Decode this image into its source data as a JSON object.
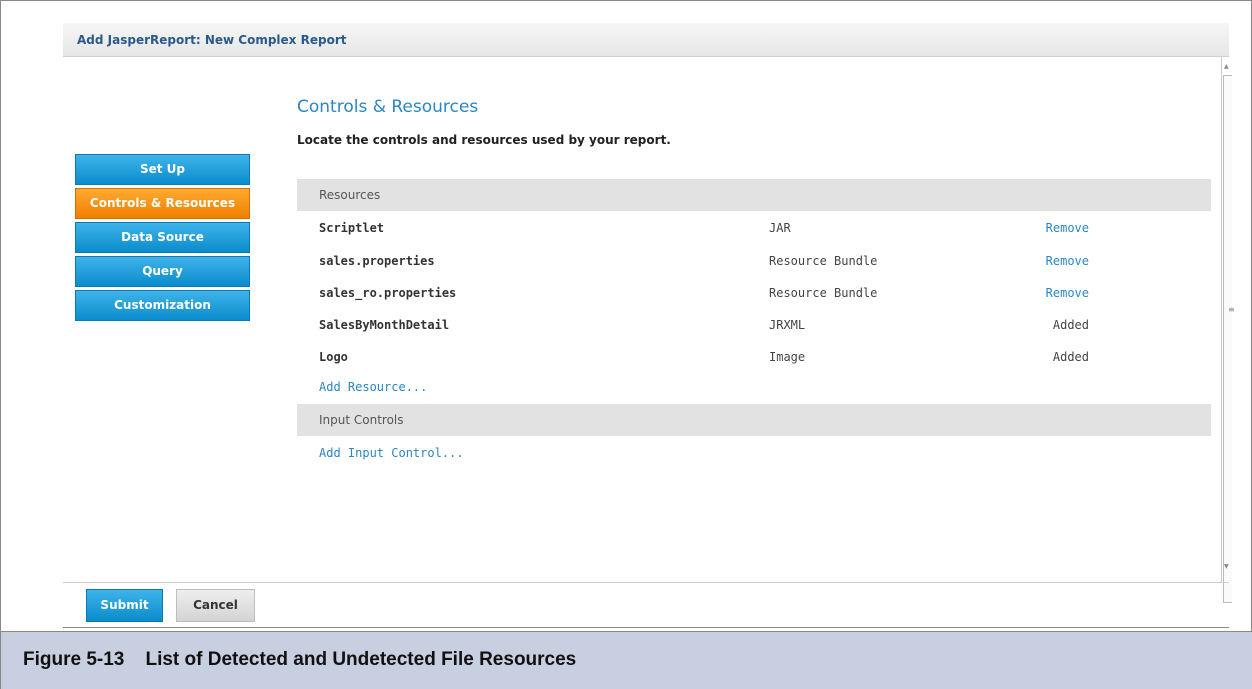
{
  "window": {
    "title": "Add JasperReport: New Complex Report"
  },
  "nav": {
    "items": [
      {
        "label": "Set Up",
        "active": false
      },
      {
        "label": "Controls & Resources",
        "active": true
      },
      {
        "label": "Data Source",
        "active": false
      },
      {
        "label": "Query",
        "active": false
      },
      {
        "label": "Customization",
        "active": false
      }
    ]
  },
  "main": {
    "title": "Controls & Resources",
    "description": "Locate the controls and resources used by your report.",
    "resources": {
      "header": "Resources",
      "rows": [
        {
          "name": "Scriptlet",
          "type": "JAR",
          "action": "Remove"
        },
        {
          "name": "sales.properties",
          "type": "Resource Bundle",
          "action": "Remove"
        },
        {
          "name": "sales_ro.properties",
          "type": "Resource Bundle",
          "action": "Remove"
        },
        {
          "name": "SalesByMonthDetail",
          "type": "JRXML",
          "action": "Added"
        },
        {
          "name": "Logo",
          "type": "Image",
          "action": "Added"
        }
      ],
      "add_link": "Add Resource..."
    },
    "input_controls": {
      "header": "Input Controls",
      "add_link": "Add Input Control..."
    }
  },
  "footer": {
    "submit": "Submit",
    "cancel": "Cancel"
  },
  "caption": "Figure 5-13    List of Detected and Undetected File Resources",
  "colors": {
    "accent": "#2b86c2",
    "nav_blue": "#0a8ccc",
    "nav_active": "#f07f00",
    "caption_bg": "#c8cfe0"
  }
}
